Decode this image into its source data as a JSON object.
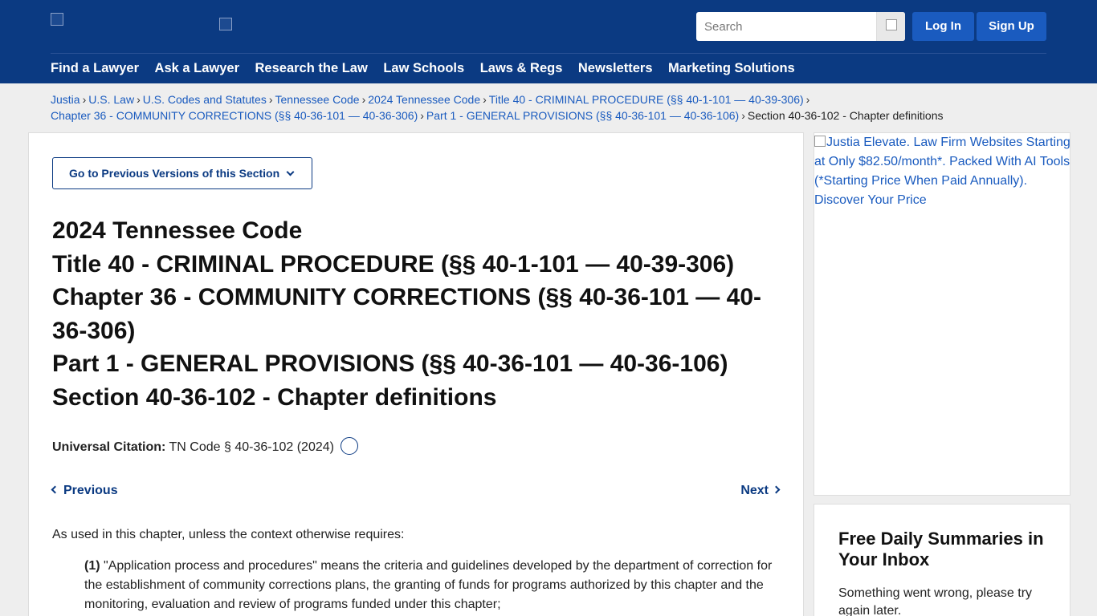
{
  "header": {
    "search_placeholder": "Search",
    "login_label": "Log In",
    "signup_label": "Sign Up",
    "nav": [
      "Find a Lawyer",
      "Ask a Lawyer",
      "Research the Law",
      "Law Schools",
      "Laws & Regs",
      "Newsletters",
      "Marketing Solutions"
    ]
  },
  "breadcrumb": {
    "items": [
      "Justia",
      "U.S. Law",
      "U.S. Codes and Statutes",
      "Tennessee Code",
      "2024 Tennessee Code",
      "Title 40 - CRIMINAL PROCEDURE (§§ 40-1-101 — 40-39-306)",
      "Chapter 36 - COMMUNITY CORRECTIONS (§§ 40-36-101 — 40-36-306)",
      "Part 1 - GENERAL PROVISIONS (§§ 40-36-101 — 40-36-106)"
    ],
    "current": "Section 40-36-102 - Chapter definitions",
    "separator": "›"
  },
  "main": {
    "prev_versions_label": "Go to Previous Versions of this Section",
    "title_lines": [
      "2024 Tennessee Code",
      "Title 40 - CRIMINAL PROCEDURE (§§ 40-1-101 — 40-39-306)",
      "Chapter 36 - COMMUNITY CORRECTIONS (§§ 40-36-101 — 40-36-306)",
      "Part 1 - GENERAL PROVISIONS (§§ 40-36-101 — 40-36-106)",
      "Section 40-36-102 - Chapter definitions"
    ],
    "citation_label": "Universal Citation:",
    "citation_value": "TN Code § 40-36-102 (2024)",
    "previous_label": "Previous",
    "next_label": "Next",
    "intro": "As used in this chapter, unless the context otherwise requires:",
    "para1_num": "(1)",
    "para1_text": "\"Application process and procedures\" means the criteria and guidelines developed by the department of correction for the establishment of community corrections plans, the granting of funds for programs authorized by this chapter and the monitoring, evaluation and review of programs funded under this chapter;"
  },
  "sidebar": {
    "ad_alt": "Justia Elevate. Law Firm Websites Starting at Only $82.50/month*. Packed With AI Tools (*Starting Price When Paid Annually). Discover Your Price",
    "newsletter_title": "Free Daily Summaries in Your Inbox",
    "newsletter_msg": "Something went wrong, please try again later."
  }
}
